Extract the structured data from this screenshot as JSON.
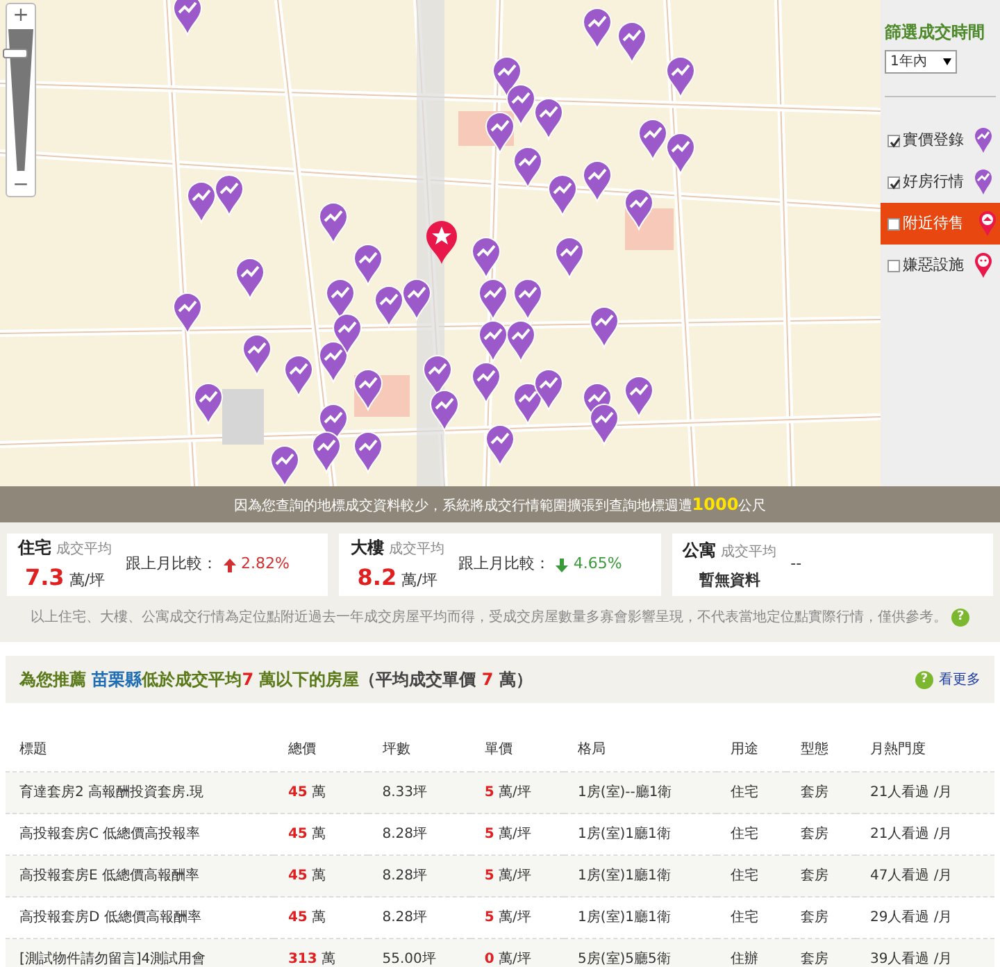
{
  "map": {
    "zoom_in": "+",
    "zoom_out": "−",
    "zoom_slider": {
      "level": 0.85
    }
  },
  "filter_panel": {
    "title": "篩選成交時間",
    "period": "1年內",
    "layers": [
      {
        "label": "實價登錄",
        "checked": true,
        "highlighted": false,
        "kind": "deal"
      },
      {
        "label": "好房行情",
        "checked": true,
        "highlighted": false,
        "kind": "deal"
      },
      {
        "label": "附近待售",
        "checked": false,
        "highlighted": true,
        "kind": "sale"
      },
      {
        "label": "嫌惡設施",
        "checked": false,
        "highlighted": false,
        "kind": "hazard"
      }
    ]
  },
  "notice": "因為您查詢的地標成交資料較少，系統將成交行情範圍擴張到查詢地標週遭**1000**公尺",
  "stats": [
    {
      "kind": "price",
      "type": "住宅",
      "label": "成交平均",
      "value": "7.3",
      "unit": "萬/坪",
      "compare_label": "跟上月比較：",
      "rising": true,
      "change": "2.82%"
    },
    {
      "kind": "price",
      "type": "大樓",
      "label": "成交平均",
      "value": "8.2",
      "unit": "萬/坪",
      "compare_label": "跟上月比較：",
      "rising": false,
      "change": "4.65%"
    },
    {
      "kind": "empty",
      "type": "公寓",
      "label": "成交平均",
      "value": "--",
      "note": "暫無資料"
    }
  ],
  "disclaimer": "以上住宅、大樓、公寓成交行情為定位點附近過去一年成交房屋平均而得，受成交房屋數量多寡會影響呈現，不代表當地定位點實際行情，僅供參考。",
  "disclaimer_help": "?",
  "recommend": {
    "prefix": "為您推薦 ",
    "region": "苗栗縣",
    "mid": "低於成交平均",
    "threshold": "7",
    "suffix": " 萬以下的房屋",
    "paren_open": "（平均成交單價 ",
    "avg": "7",
    "paren_close": " 萬）",
    "help": "?",
    "more": "看更多"
  },
  "table": {
    "columns": [
      "標題",
      "總價",
      "坪數",
      "單價",
      "格局",
      "用途",
      "型態",
      "月熱門度"
    ],
    "rows": [
      {
        "title": "育達套房2 高報酬投資套房.現",
        "total": "45",
        "total_unit": "萬",
        "area": "8.33坪",
        "price": "5",
        "price_unit": "萬/坪",
        "layout": "1房(室)--廳1衛",
        "use": "住宅",
        "type": "套房",
        "views": "21人看過 /月"
      },
      {
        "title": "高投報套房C 低總價高投報率",
        "total": "45",
        "total_unit": "萬",
        "area": "8.28坪",
        "price": "5",
        "price_unit": "萬/坪",
        "layout": "1房(室)1廳1衛",
        "use": "住宅",
        "type": "套房",
        "views": "21人看過 /月"
      },
      {
        "title": "高投報套房E 低總價高報酬率",
        "total": "45",
        "total_unit": "萬",
        "area": "8.28坪",
        "price": "5",
        "price_unit": "萬/坪",
        "layout": "1房(室)1廳1衛",
        "use": "住宅",
        "type": "套房",
        "views": "47人看過 /月"
      },
      {
        "title": "高投報套房D 低總價高報酬率",
        "total": "45",
        "total_unit": "萬",
        "area": "8.28坪",
        "price": "5",
        "price_unit": "萬/坪",
        "layout": "1房(室)1廳1衛",
        "use": "住宅",
        "type": "套房",
        "views": "29人看過 /月"
      },
      {
        "title": "[測試物件請勿留言]4測試用會",
        "total": "313",
        "total_unit": "萬",
        "area": "55.00坪",
        "price": "0",
        "price_unit": "萬/坪",
        "layout": "5房(室)5廳5衛",
        "use": "住辦",
        "type": "套房",
        "views": "39人看過 /月"
      }
    ]
  }
}
